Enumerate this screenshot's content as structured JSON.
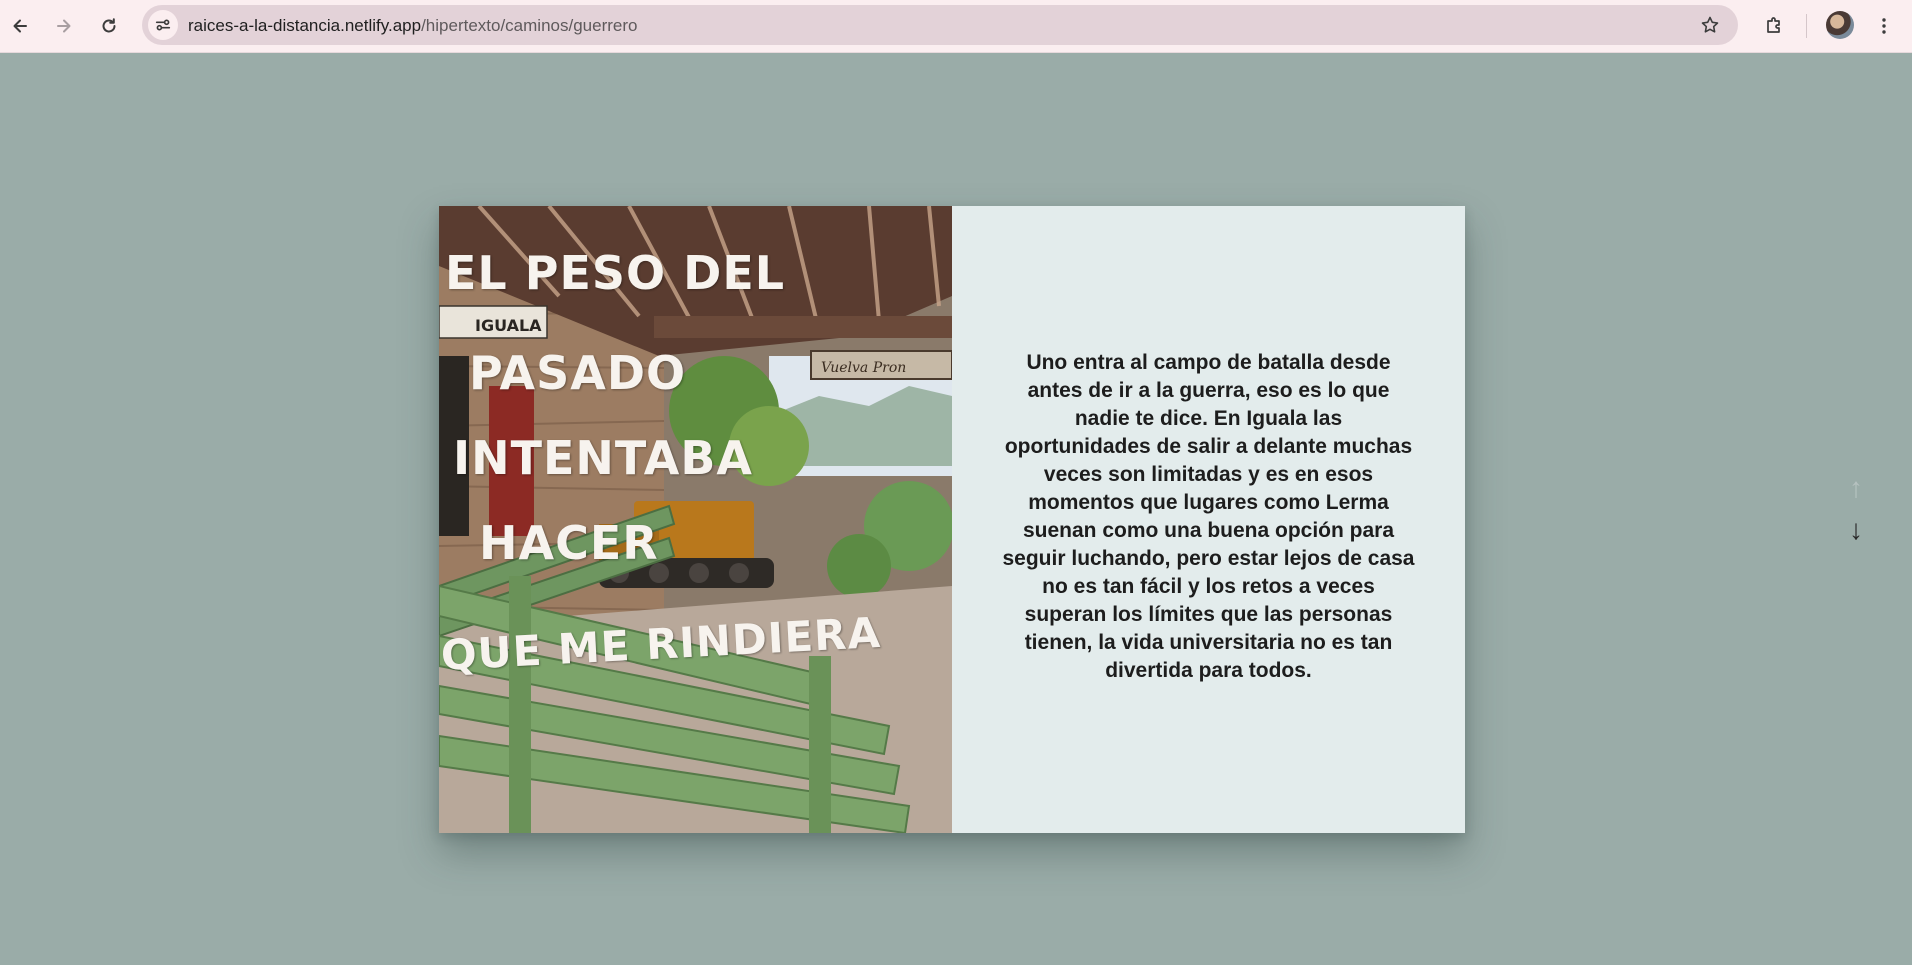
{
  "browser": {
    "url_host": "raices-a-la-distancia.netlify.app",
    "url_path": "/hipertexto/caminos/guerrero",
    "icons": [
      "back-icon",
      "forward-icon",
      "reload-icon",
      "site-info-icon",
      "bookmark-star-icon",
      "extensions-icon",
      "profile-avatar",
      "more-menu-icon"
    ]
  },
  "photo": {
    "sign_station": "IGUALA",
    "sign_platform": "Vuelva Pron",
    "title_lines": [
      "EL PESO DEL",
      "PASADO",
      "INTENTABA",
      "HACER",
      "QUE ME RINDIERA"
    ]
  },
  "story": {
    "text": "Uno entra al campo de batalla desde antes de ir a la guerra, eso es lo que nadie te dice. En Iguala las oportunidades de salir a delante muchas veces son limitadas y es en esos momentos que lugares como Lerma suenan como una buena opción para seguir luchando, pero estar lejos de casa no es tan fácil y los retos a veces superan los límites que las personas tienen, la vida universitaria no es tan divertida para todos."
  },
  "navigation": {
    "up_arrow": "↑",
    "down_arrow": "↓",
    "up_color": "#b6c2c0",
    "down_color": "#2a2a2a"
  },
  "colors": {
    "page_bg": "#9aaca8",
    "panel_bg": "#e3ecec",
    "chrome_bg": "#fbeef0"
  }
}
